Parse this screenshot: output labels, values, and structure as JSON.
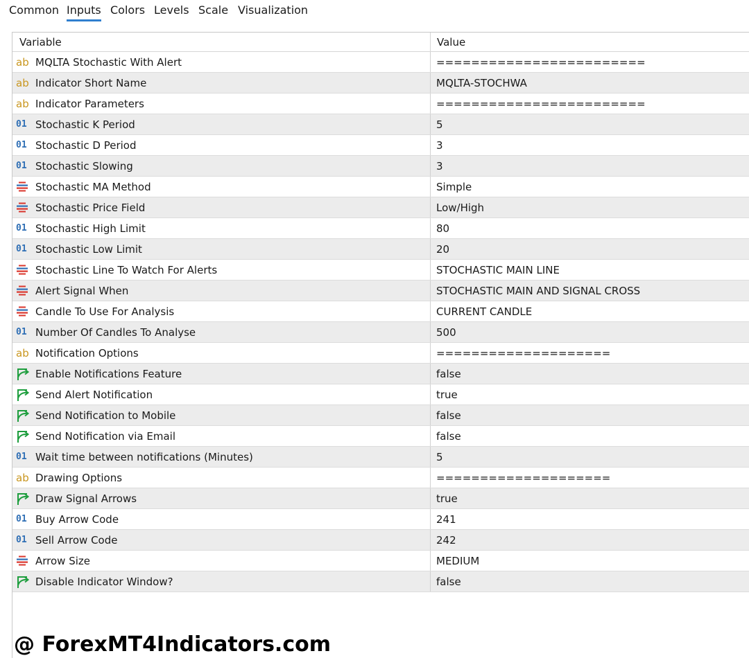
{
  "tabs": [
    {
      "label": "Common",
      "active": false
    },
    {
      "label": "Inputs",
      "active": true
    },
    {
      "label": "Colors",
      "active": false
    },
    {
      "label": "Levels",
      "active": false
    },
    {
      "label": "Scale",
      "active": false
    },
    {
      "label": "Visualization",
      "active": false
    }
  ],
  "table": {
    "headers": {
      "variable": "Variable",
      "value": "Value"
    },
    "rows": [
      {
        "icon": "string-icon",
        "variable": "MQLTA Stochastic With Alert",
        "value": "========================"
      },
      {
        "icon": "string-icon",
        "variable": "Indicator Short Name",
        "value": "MQLTA-STOCHWA"
      },
      {
        "icon": "string-icon",
        "variable": "Indicator Parameters",
        "value": "========================"
      },
      {
        "icon": "integer-icon",
        "variable": "Stochastic K Period",
        "value": "5"
      },
      {
        "icon": "integer-icon",
        "variable": "Stochastic D Period",
        "value": "3"
      },
      {
        "icon": "integer-icon",
        "variable": "Stochastic Slowing",
        "value": "3"
      },
      {
        "icon": "enum-icon",
        "variable": "Stochastic MA Method",
        "value": "Simple"
      },
      {
        "icon": "enum-icon",
        "variable": "Stochastic Price Field",
        "value": "Low/High"
      },
      {
        "icon": "integer-icon",
        "variable": "Stochastic High Limit",
        "value": "80"
      },
      {
        "icon": "integer-icon",
        "variable": "Stochastic Low Limit",
        "value": "20"
      },
      {
        "icon": "enum-icon",
        "variable": "Stochastic Line To Watch For Alerts",
        "value": "STOCHASTIC MAIN LINE"
      },
      {
        "icon": "enum-icon",
        "variable": "Alert Signal When",
        "value": "STOCHASTIC MAIN AND SIGNAL CROSS"
      },
      {
        "icon": "enum-icon",
        "variable": "Candle To Use For Analysis",
        "value": "CURRENT CANDLE"
      },
      {
        "icon": "integer-icon",
        "variable": "Number Of Candles To Analyse",
        "value": "500"
      },
      {
        "icon": "string-icon",
        "variable": "Notification Options",
        "value": "===================="
      },
      {
        "icon": "bool-icon",
        "variable": "Enable Notifications Feature",
        "value": "false"
      },
      {
        "icon": "bool-icon",
        "variable": "Send Alert Notification",
        "value": "true"
      },
      {
        "icon": "bool-icon",
        "variable": "Send Notification to Mobile",
        "value": "false"
      },
      {
        "icon": "bool-icon",
        "variable": "Send Notification via Email",
        "value": "false"
      },
      {
        "icon": "integer-icon",
        "variable": "Wait time between notifications (Minutes)",
        "value": "5"
      },
      {
        "icon": "string-icon",
        "variable": "Drawing Options",
        "value": "===================="
      },
      {
        "icon": "bool-icon",
        "variable": "Draw Signal Arrows",
        "value": "true"
      },
      {
        "icon": "integer-icon",
        "variable": "Buy Arrow Code",
        "value": "241"
      },
      {
        "icon": "integer-icon",
        "variable": "Sell Arrow Code",
        "value": "242"
      },
      {
        "icon": "enum-icon",
        "variable": "Arrow Size",
        "value": "MEDIUM"
      },
      {
        "icon": "bool-icon",
        "variable": "Disable Indicator Window?",
        "value": "false"
      }
    ]
  },
  "icons": {
    "string_glyph": "ab",
    "integer_glyph": "01"
  },
  "colors": {
    "tab_accent": "#2f7fcf",
    "string_icon": "#c9961e",
    "integer_icon": "#2f6fb5",
    "enum_icon_red": "#d9342b",
    "enum_icon_blue": "#2f6fb5",
    "bool_icon": "#1e9e3e",
    "row_alt": "#ececec"
  },
  "watermark": "@ ForexMT4Indicators.com"
}
